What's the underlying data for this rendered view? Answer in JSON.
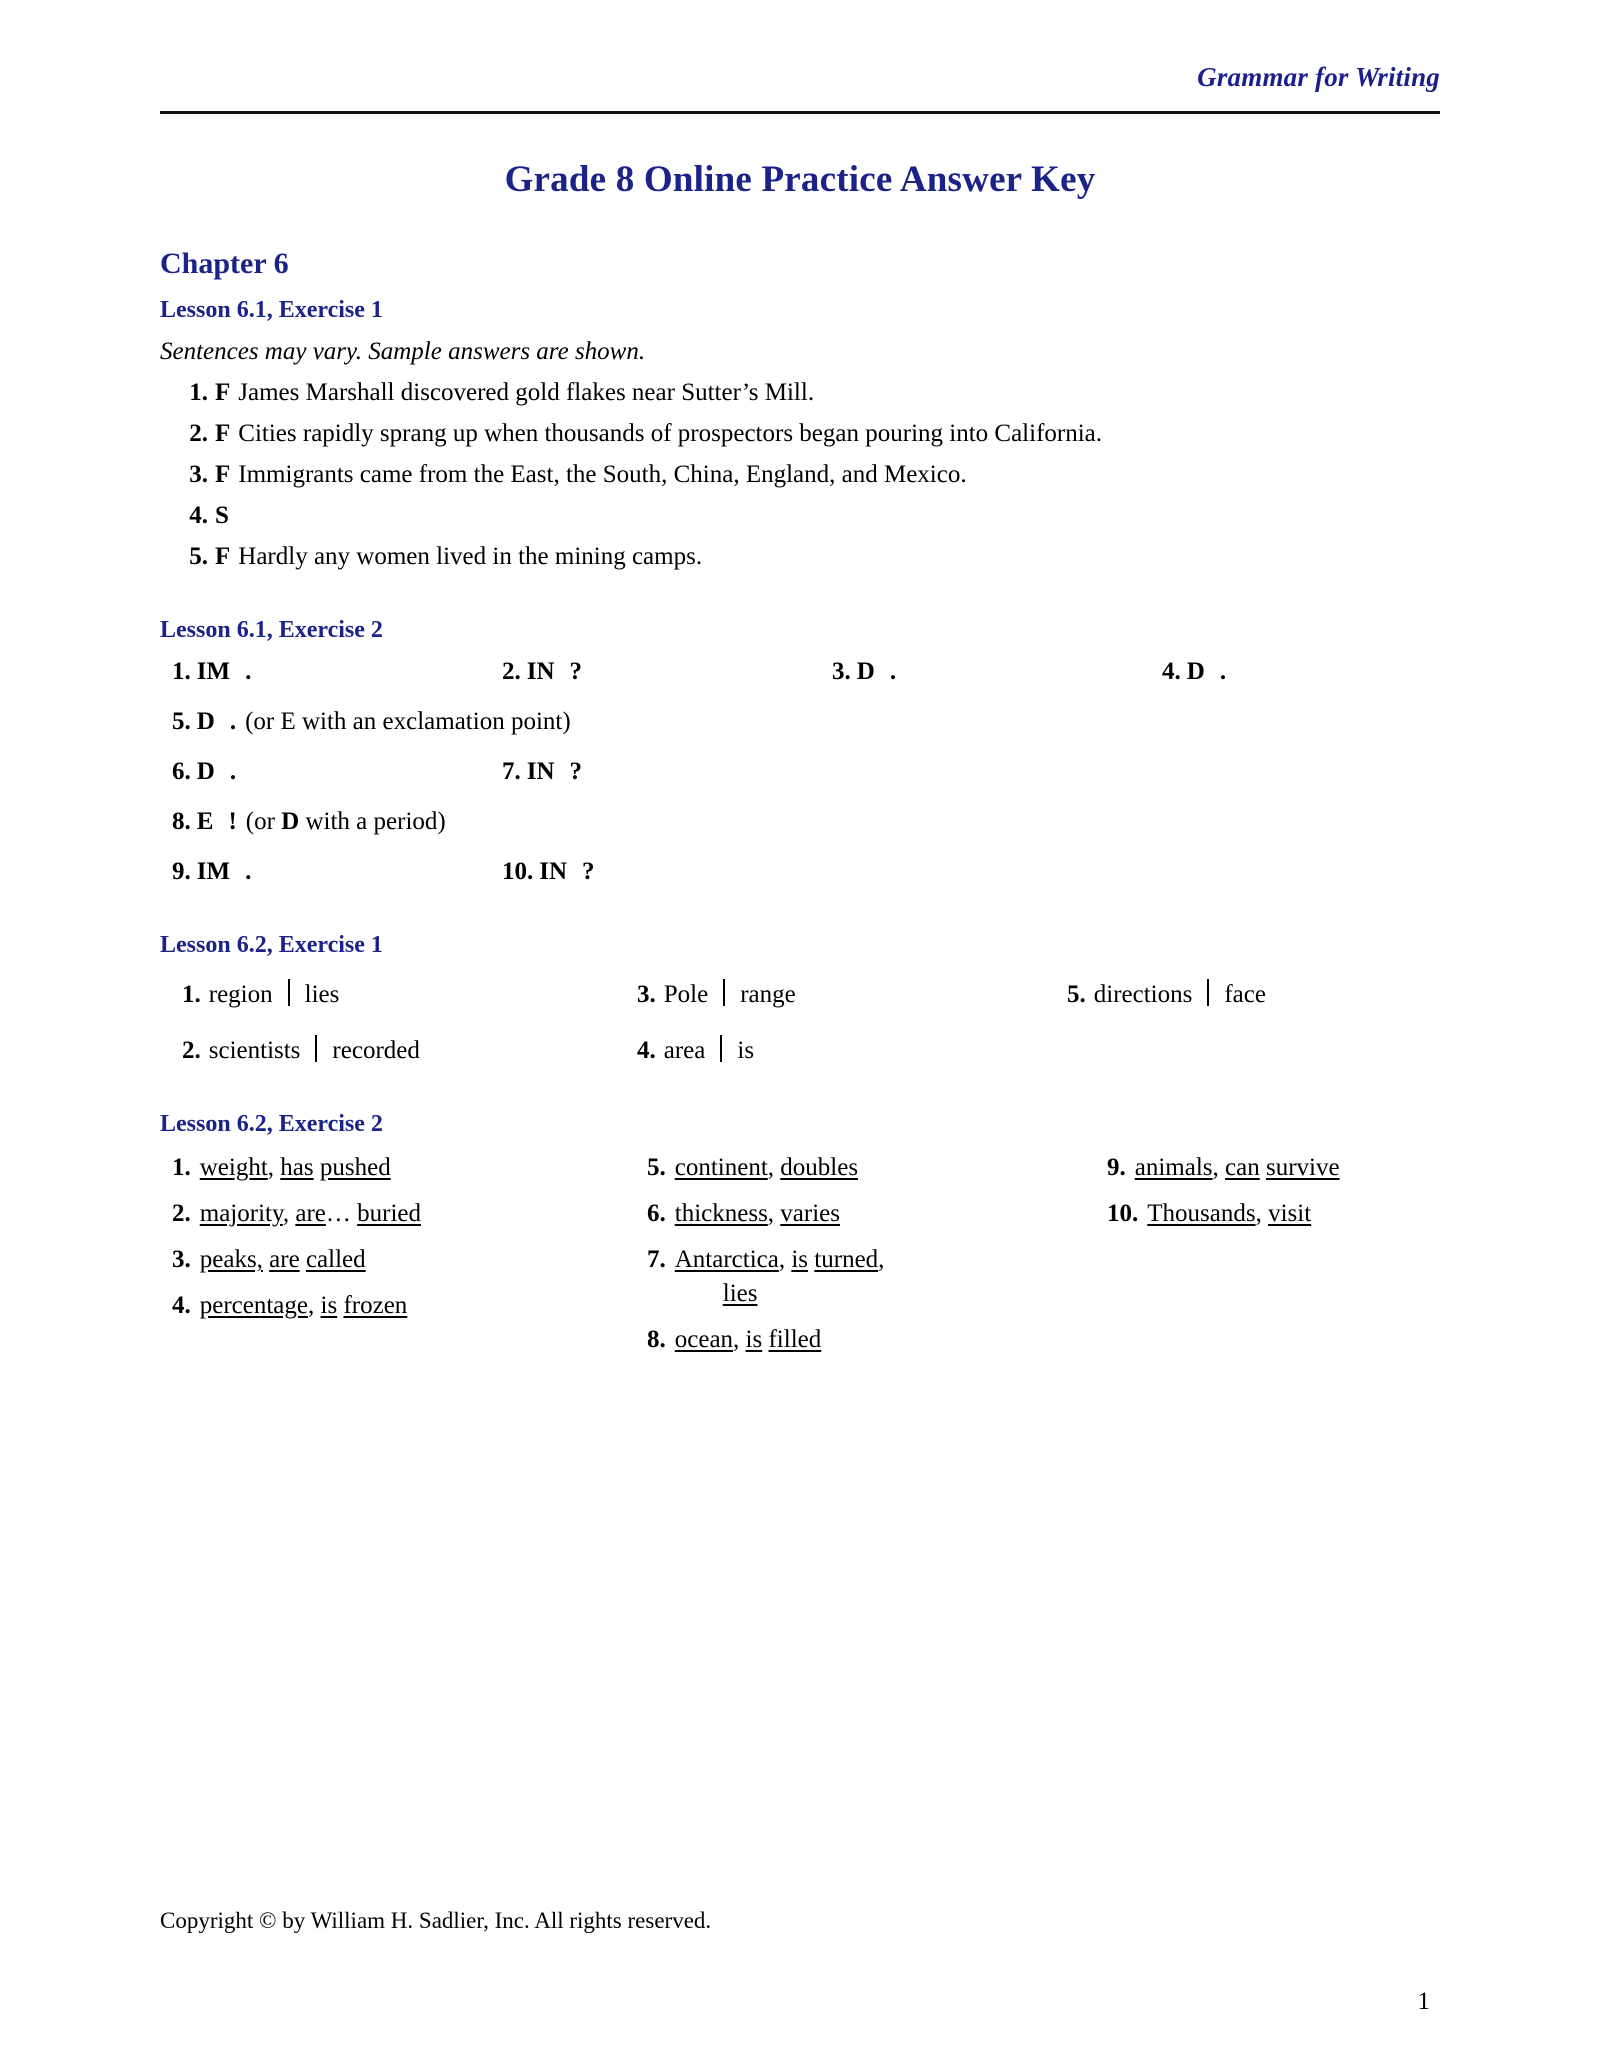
{
  "header": {
    "running_head": "Grammar for Writing",
    "title": "Grade 8 Online Practice Answer Key"
  },
  "chapter": {
    "label": "Chapter 6"
  },
  "sections": [
    {
      "heading": "Lesson 6.1, Exercise 1",
      "note": "Sentences may vary. Sample answers are shown.",
      "items": [
        {
          "num": "1.",
          "code": "F",
          "sentence": "James Marshall discovered gold flakes near Sutter’s Mill."
        },
        {
          "num": "2.",
          "code": "F",
          "sentence": "Cities rapidly sprang up when thousands of prospectors began pouring into California."
        },
        {
          "num": "3.",
          "code": "F",
          "sentence": "Immigrants came from the East, the South, China, England, and Mexico."
        },
        {
          "num": "4.",
          "code": "S",
          "sentence": ""
        },
        {
          "num": "5.",
          "code": "F",
          "sentence": "Hardly any women lived in the mining camps."
        }
      ]
    },
    {
      "heading": "Lesson 6.1, Exercise 2",
      "items": [
        {
          "num": "1.",
          "code": "IM",
          "punct": ".",
          "paren": ""
        },
        {
          "num": "2.",
          "code": "IN",
          "punct": "?",
          "paren": ""
        },
        {
          "num": "3.",
          "code": "D",
          "punct": ".",
          "paren": ""
        },
        {
          "num": "4.",
          "code": "D",
          "punct": ".",
          "paren": ""
        },
        {
          "num": "5.",
          "code": "D",
          "punct": ".",
          "paren_pre": "(or E with an exclamation point)"
        },
        {
          "num": "6.",
          "code": "D",
          "punct": ".",
          "paren": ""
        },
        {
          "num": "7.",
          "code": "IN",
          "punct": "?",
          "paren": ""
        },
        {
          "num": "8.",
          "code": "E",
          "punct": "!",
          "paren_pre": "(or D with a period)",
          "paren_bold": "D"
        },
        {
          "num": "9.",
          "code": "IM",
          "punct": ".",
          "paren": ""
        },
        {
          "num": "10.",
          "code": "IN",
          "punct": "?",
          "paren": ""
        }
      ],
      "paren5_before": "(or E with an exclamation point)",
      "paren8_a": "(or ",
      "paren8_b": "D",
      "paren8_c": " with a period)"
    },
    {
      "heading": "Lesson 6.2, Exercise 1",
      "items": [
        {
          "num": "1.",
          "left": "region",
          "right": "lies"
        },
        {
          "num": "2.",
          "left": "scientists",
          "right": "recorded"
        },
        {
          "num": "3.",
          "left": "Pole",
          "right": "range"
        },
        {
          "num": "4.",
          "left": "area",
          "right": "is"
        },
        {
          "num": "5.",
          "left": "directions",
          "right": "face"
        }
      ]
    },
    {
      "heading": "Lesson 6.2, Exercise 2",
      "items": [
        {
          "num": "1.",
          "parts": "weight, has pushed"
        },
        {
          "num": "2.",
          "parts": "majority, are… buried"
        },
        {
          "num": "3.",
          "parts": "peaks, are called"
        },
        {
          "num": "4.",
          "parts": "percentage, is frozen"
        },
        {
          "num": "5.",
          "parts": "continent, doubles"
        },
        {
          "num": "6.",
          "parts": "thickness, varies"
        },
        {
          "num": "7.",
          "parts": "Antarctica, is turned, lies"
        },
        {
          "num": "8.",
          "parts": "ocean, is filled"
        },
        {
          "num": "9.",
          "parts": "animals, can survive"
        },
        {
          "num": "10.",
          "parts": "Thousands, visit"
        }
      ]
    }
  ],
  "ex61_2": {
    "r1c1_num": "1.",
    "r1c1_code": "IM",
    "r1c1_punct": ".",
    "r1c2_num": "2.",
    "r1c2_code": "IN",
    "r1c2_punct": "?",
    "r1c3_num": "3.",
    "r1c3_code": "D",
    "r1c3_punct": ".",
    "r1c4_num": "4.",
    "r1c4_code": "D",
    "r1c4_punct": ".",
    "r2_num": "5.",
    "r2_code": "D",
    "r2_punct": ".",
    "r2_note": "(or E with an exclamation point)",
    "r3c1_num": "6.",
    "r3c1_code": "D",
    "r3c1_punct": ".",
    "r3c2_num": "7.",
    "r3c2_code": "IN",
    "r3c2_punct": "?",
    "r4_num": "8.",
    "r4_code": "E",
    "r4_punct": "!",
    "r4_note_a": "(or ",
    "r4_note_b": "D",
    "r4_note_c": " with a period)",
    "r5c1_num": "9.",
    "r5c1_code": "IM",
    "r5c1_punct": ".",
    "r5c2_num": "10.",
    "r5c2_code": "IN",
    "r5c2_punct": "?"
  },
  "ex62_1": {
    "i1_num": "1.",
    "i1_left": "region",
    "i1_right": "lies",
    "i2_num": "2.",
    "i2_left": "scientists",
    "i2_right": "recorded",
    "i3_num": "3.",
    "i3_left": "Pole",
    "i3_right": "range",
    "i4_num": "4.",
    "i4_left": "area",
    "i4_right": "is",
    "i5_num": "5.",
    "i5_left": "directions",
    "i5_right": "face"
  },
  "ex62_2": {
    "i1_num": "1.",
    "i1_a": "weight",
    "i1_b": "has",
    "i1_c": "pushed",
    "i2_num": "2.",
    "i2_a": "majority",
    "i2_b": "are",
    "i2_ell": "…",
    "i2_c": "buried",
    "i3_num": "3.",
    "i3_a": "peaks,",
    "i3_b": "are",
    "i3_c": "called",
    "i4_num": "4.",
    "i4_a": "percentage",
    "i4_b": "is",
    "i4_c": "frozen",
    "i5_num": "5.",
    "i5_a": "continent",
    "i5_b": "doubles",
    "i6_num": "6.",
    "i6_a": "thickness",
    "i6_b": "varies",
    "i7_num": "7.",
    "i7_a": "Antarctica",
    "i7_b": "is",
    "i7_c": "turned",
    "i7_d": "lies",
    "i8_num": "8.",
    "i8_a": "ocean",
    "i8_b": "is",
    "i8_c": "filled",
    "i9_num": "9.",
    "i9_a": "animals",
    "i9_b": "can",
    "i9_c": "survive",
    "i10_num": "10.",
    "i10_a": "Thousands",
    "i10_b": "visit"
  },
  "footer": {
    "copyright": "Copyright © by William H. Sadlier, Inc. All rights reserved.",
    "page_number": "1"
  }
}
